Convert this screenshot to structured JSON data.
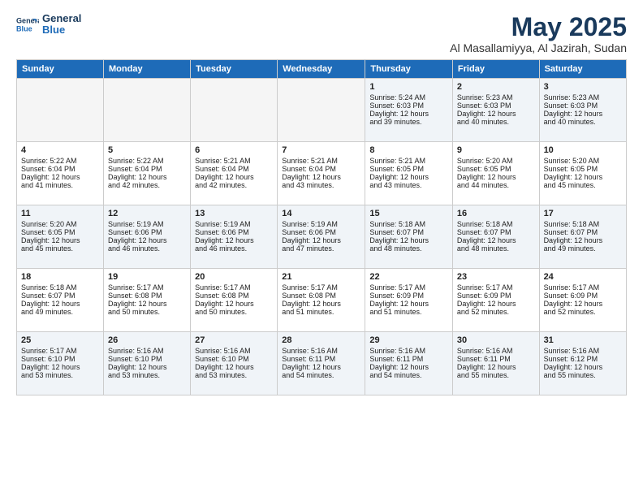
{
  "header": {
    "logo_line1": "General",
    "logo_line2": "Blue",
    "title": "May 2025",
    "subtitle": "Al Masallamiyya, Al Jazirah, Sudan"
  },
  "columns": [
    "Sunday",
    "Monday",
    "Tuesday",
    "Wednesday",
    "Thursday",
    "Friday",
    "Saturday"
  ],
  "weeks": [
    [
      {
        "day": "",
        "info": ""
      },
      {
        "day": "",
        "info": ""
      },
      {
        "day": "",
        "info": ""
      },
      {
        "day": "",
        "info": ""
      },
      {
        "day": "1",
        "info": "Sunrise: 5:24 AM\nSunset: 6:03 PM\nDaylight: 12 hours\nand 39 minutes."
      },
      {
        "day": "2",
        "info": "Sunrise: 5:23 AM\nSunset: 6:03 PM\nDaylight: 12 hours\nand 40 minutes."
      },
      {
        "day": "3",
        "info": "Sunrise: 5:23 AM\nSunset: 6:03 PM\nDaylight: 12 hours\nand 40 minutes."
      }
    ],
    [
      {
        "day": "4",
        "info": "Sunrise: 5:22 AM\nSunset: 6:04 PM\nDaylight: 12 hours\nand 41 minutes."
      },
      {
        "day": "5",
        "info": "Sunrise: 5:22 AM\nSunset: 6:04 PM\nDaylight: 12 hours\nand 42 minutes."
      },
      {
        "day": "6",
        "info": "Sunrise: 5:21 AM\nSunset: 6:04 PM\nDaylight: 12 hours\nand 42 minutes."
      },
      {
        "day": "7",
        "info": "Sunrise: 5:21 AM\nSunset: 6:04 PM\nDaylight: 12 hours\nand 43 minutes."
      },
      {
        "day": "8",
        "info": "Sunrise: 5:21 AM\nSunset: 6:05 PM\nDaylight: 12 hours\nand 43 minutes."
      },
      {
        "day": "9",
        "info": "Sunrise: 5:20 AM\nSunset: 6:05 PM\nDaylight: 12 hours\nand 44 minutes."
      },
      {
        "day": "10",
        "info": "Sunrise: 5:20 AM\nSunset: 6:05 PM\nDaylight: 12 hours\nand 45 minutes."
      }
    ],
    [
      {
        "day": "11",
        "info": "Sunrise: 5:20 AM\nSunset: 6:05 PM\nDaylight: 12 hours\nand 45 minutes."
      },
      {
        "day": "12",
        "info": "Sunrise: 5:19 AM\nSunset: 6:06 PM\nDaylight: 12 hours\nand 46 minutes."
      },
      {
        "day": "13",
        "info": "Sunrise: 5:19 AM\nSunset: 6:06 PM\nDaylight: 12 hours\nand 46 minutes."
      },
      {
        "day": "14",
        "info": "Sunrise: 5:19 AM\nSunset: 6:06 PM\nDaylight: 12 hours\nand 47 minutes."
      },
      {
        "day": "15",
        "info": "Sunrise: 5:18 AM\nSunset: 6:07 PM\nDaylight: 12 hours\nand 48 minutes."
      },
      {
        "day": "16",
        "info": "Sunrise: 5:18 AM\nSunset: 6:07 PM\nDaylight: 12 hours\nand 48 minutes."
      },
      {
        "day": "17",
        "info": "Sunrise: 5:18 AM\nSunset: 6:07 PM\nDaylight: 12 hours\nand 49 minutes."
      }
    ],
    [
      {
        "day": "18",
        "info": "Sunrise: 5:18 AM\nSunset: 6:07 PM\nDaylight: 12 hours\nand 49 minutes."
      },
      {
        "day": "19",
        "info": "Sunrise: 5:17 AM\nSunset: 6:08 PM\nDaylight: 12 hours\nand 50 minutes."
      },
      {
        "day": "20",
        "info": "Sunrise: 5:17 AM\nSunset: 6:08 PM\nDaylight: 12 hours\nand 50 minutes."
      },
      {
        "day": "21",
        "info": "Sunrise: 5:17 AM\nSunset: 6:08 PM\nDaylight: 12 hours\nand 51 minutes."
      },
      {
        "day": "22",
        "info": "Sunrise: 5:17 AM\nSunset: 6:09 PM\nDaylight: 12 hours\nand 51 minutes."
      },
      {
        "day": "23",
        "info": "Sunrise: 5:17 AM\nSunset: 6:09 PM\nDaylight: 12 hours\nand 52 minutes."
      },
      {
        "day": "24",
        "info": "Sunrise: 5:17 AM\nSunset: 6:09 PM\nDaylight: 12 hours\nand 52 minutes."
      }
    ],
    [
      {
        "day": "25",
        "info": "Sunrise: 5:17 AM\nSunset: 6:10 PM\nDaylight: 12 hours\nand 53 minutes."
      },
      {
        "day": "26",
        "info": "Sunrise: 5:16 AM\nSunset: 6:10 PM\nDaylight: 12 hours\nand 53 minutes."
      },
      {
        "day": "27",
        "info": "Sunrise: 5:16 AM\nSunset: 6:10 PM\nDaylight: 12 hours\nand 53 minutes."
      },
      {
        "day": "28",
        "info": "Sunrise: 5:16 AM\nSunset: 6:11 PM\nDaylight: 12 hours\nand 54 minutes."
      },
      {
        "day": "29",
        "info": "Sunrise: 5:16 AM\nSunset: 6:11 PM\nDaylight: 12 hours\nand 54 minutes."
      },
      {
        "day": "30",
        "info": "Sunrise: 5:16 AM\nSunset: 6:11 PM\nDaylight: 12 hours\nand 55 minutes."
      },
      {
        "day": "31",
        "info": "Sunrise: 5:16 AM\nSunset: 6:12 PM\nDaylight: 12 hours\nand 55 minutes."
      }
    ]
  ]
}
